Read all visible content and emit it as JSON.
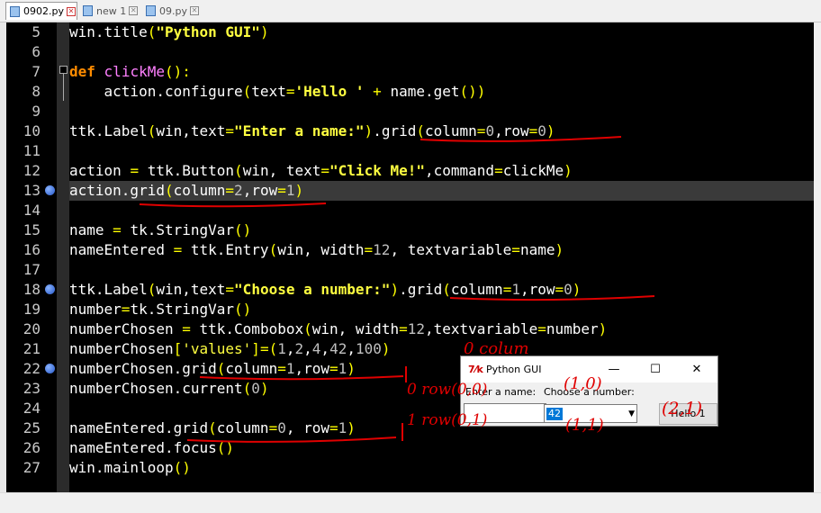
{
  "tabs": [
    {
      "label": "0902.py",
      "active": true
    },
    {
      "label": "new 1",
      "active": false
    },
    {
      "label": "09.py",
      "active": false
    }
  ],
  "editor": {
    "current_line": 13,
    "bookmarked_lines": [
      13,
      18,
      22
    ],
    "line_numbers": [
      "5",
      "6",
      "7",
      "8",
      "9",
      "10",
      "11",
      "12",
      "13",
      "14",
      "15",
      "16",
      "17",
      "18",
      "19",
      "20",
      "21",
      "22",
      "23",
      "24",
      "25",
      "26",
      "27"
    ]
  },
  "tk_window": {
    "title": "Python GUI",
    "icon": "tk-feather-icon",
    "minimize_glyph": "—",
    "maximize_glyph": "☐",
    "close_glyph": "✕",
    "label_name": "Enter a name:",
    "label_number": "Choose a number:",
    "combo_value": "42",
    "button_label": "Hello 1"
  },
  "annotations": {
    "note_column": "0 colum",
    "note_row0": "0 row(0,0)",
    "note_row1": "1 row(0,1)",
    "note_10": "(1,0)",
    "note_11": "(1,1)",
    "note_21": "(2,1)"
  },
  "colors": {
    "editor_bg": "#000000",
    "keyword": "#ff8c00",
    "string": "#ffff40",
    "function": "#ff80ff",
    "ink": "#e00000"
  }
}
